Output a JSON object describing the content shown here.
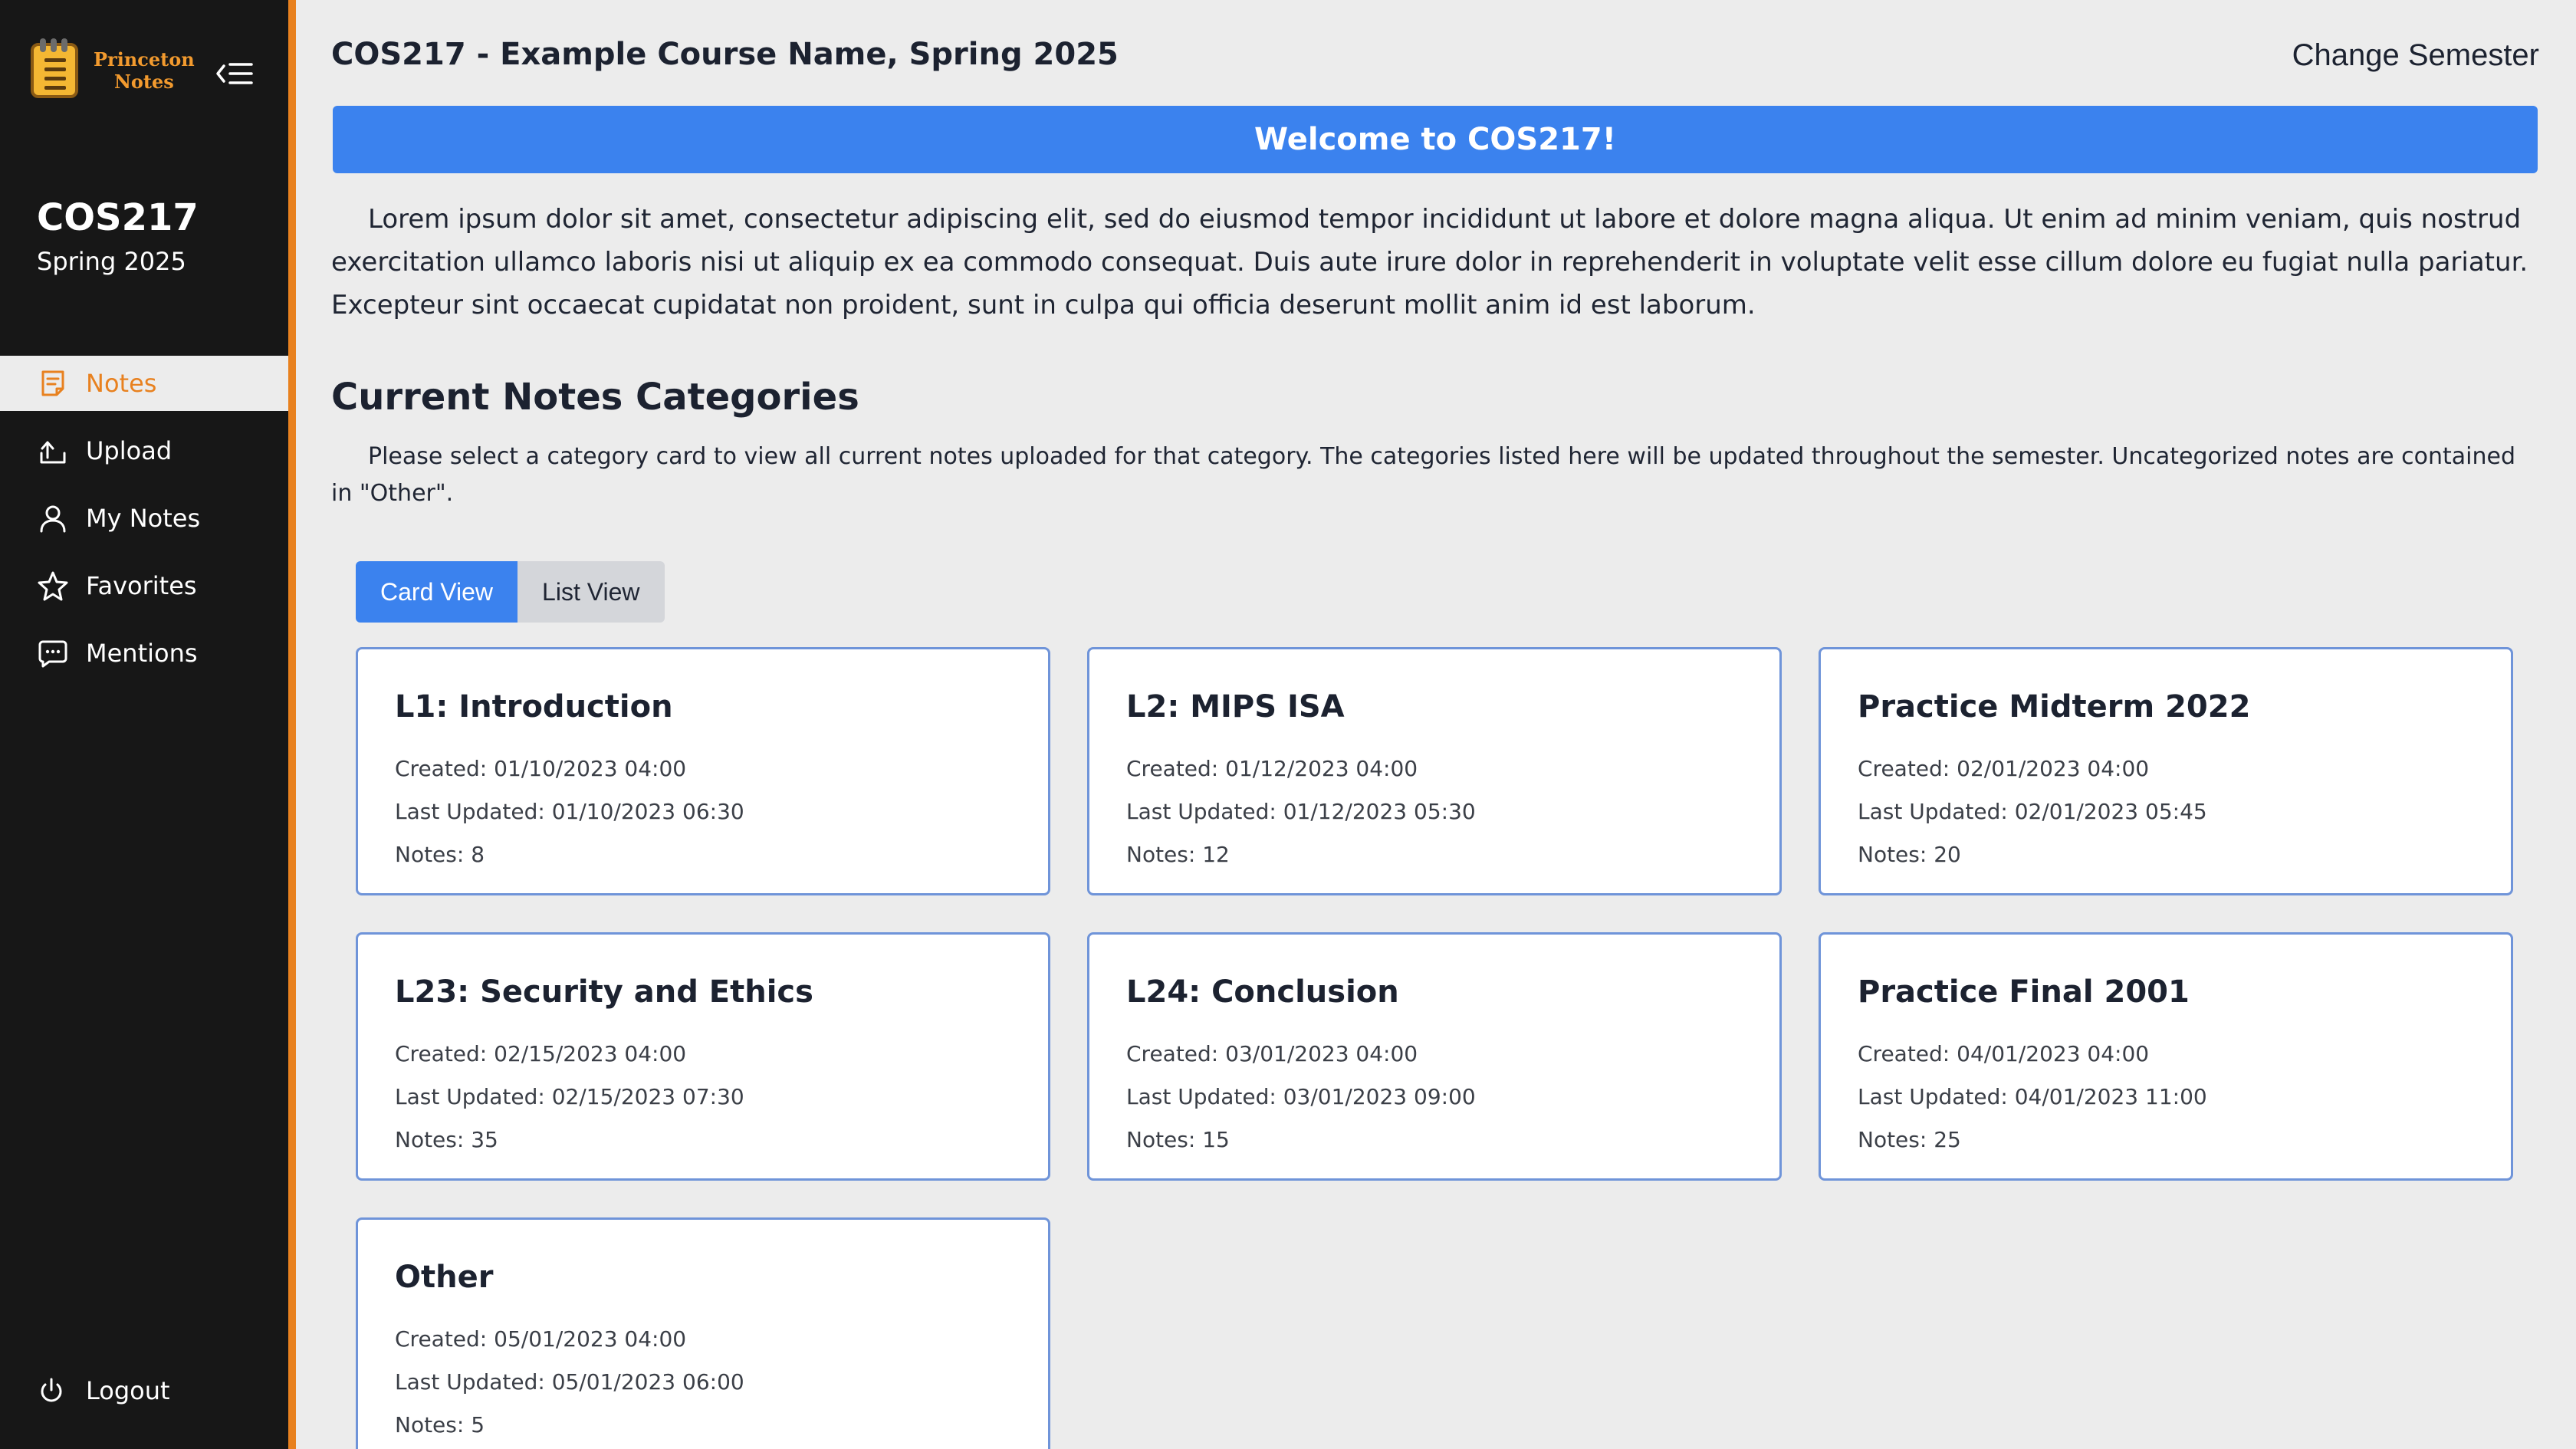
{
  "app": {
    "logo_line1": "Princeton",
    "logo_line2": "Notes"
  },
  "sidebar": {
    "course_code": "COS217",
    "semester": "Spring 2025",
    "items": [
      {
        "label": "Notes",
        "icon": "notes-icon",
        "active": true
      },
      {
        "label": "Upload",
        "icon": "upload-icon",
        "active": false
      },
      {
        "label": "My Notes",
        "icon": "user-icon",
        "active": false
      },
      {
        "label": "Favorites",
        "icon": "star-icon",
        "active": false
      },
      {
        "label": "Mentions",
        "icon": "chat-icon",
        "active": false
      }
    ],
    "logout_label": "Logout"
  },
  "header": {
    "title": "COS217 - Example Course Name, Spring 2025",
    "change_semester": "Change Semester"
  },
  "welcome": "Welcome to COS217!",
  "intro": "Lorem ipsum dolor sit amet, consectetur adipiscing elit, sed do eiusmod tempor incididunt ut labore et dolore magna aliqua. Ut enim ad minim veniam, quis nostrud exercitation ullamco laboris nisi ut aliquip ex ea commodo consequat. Duis aute irure dolor in reprehenderit in voluptate velit esse cillum dolore eu fugiat nulla pariatur. Excepteur sint occaecat cupidatat non proident, sunt in culpa qui officia deserunt mollit anim id est laborum.",
  "categories_section": {
    "title": "Current Notes Categories",
    "description": "Please select a category card to view all current notes uploaded for that category. The categories listed here will be updated throughout the semester. Uncategorized notes are contained in \"Other\".",
    "view_toggle": {
      "card": "Card View",
      "list": "List View",
      "selected": "card"
    }
  },
  "cards": [
    {
      "title": "L1: Introduction",
      "created": "Created: 01/10/2023 04:00",
      "updated": "Last Updated: 01/10/2023 06:30",
      "notes": "Notes: 8"
    },
    {
      "title": "L2: MIPS ISA",
      "created": "Created: 01/12/2023 04:00",
      "updated": "Last Updated: 01/12/2023 05:30",
      "notes": "Notes: 12"
    },
    {
      "title": "Practice Midterm 2022",
      "created": "Created: 02/01/2023 04:00",
      "updated": "Last Updated: 02/01/2023 05:45",
      "notes": "Notes: 20"
    },
    {
      "title": "L23: Security and Ethics",
      "created": "Created: 02/15/2023 04:00",
      "updated": "Last Updated: 02/15/2023 07:30",
      "notes": "Notes: 35"
    },
    {
      "title": "L24: Conclusion",
      "created": "Created: 03/01/2023 04:00",
      "updated": "Last Updated: 03/01/2023 09:00",
      "notes": "Notes: 15"
    },
    {
      "title": "Practice Final 2001",
      "created": "Created: 04/01/2023 04:00",
      "updated": "Last Updated: 04/01/2023 11:00",
      "notes": "Notes: 25"
    },
    {
      "title": "Other",
      "created": "Created: 05/01/2023 04:00",
      "updated": "Last Updated: 05/01/2023 06:00",
      "notes": "Notes: 5"
    }
  ],
  "colors": {
    "accent": "#e8811f",
    "primary": "#3b82ee",
    "sidebar_bg": "#171717",
    "page_bg": "#ececec"
  }
}
